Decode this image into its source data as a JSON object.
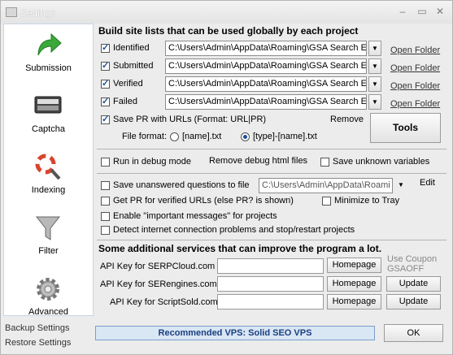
{
  "window": {
    "title": "Settings"
  },
  "sidebar": {
    "items": [
      {
        "label": "Submission",
        "icon": "green-arrow-icon"
      },
      {
        "label": "Captcha",
        "icon": "captcha-icon"
      },
      {
        "label": "Indexing",
        "icon": "lifebuoy-magnifier-icon"
      },
      {
        "label": "Filter",
        "icon": "funnel-icon"
      },
      {
        "label": "Advanced",
        "icon": "gear-icon"
      }
    ],
    "backup_label": "Backup Settings",
    "restore_label": "Restore Settings"
  },
  "sitelists": {
    "heading": "Build site lists that can be used globally by each project",
    "rows": [
      {
        "label": "Identified",
        "checked": true,
        "path": "C:\\Users\\Admin\\AppData\\Roaming\\GSA Search E",
        "open": "Open Folder"
      },
      {
        "label": "Submitted",
        "checked": true,
        "path": "C:\\Users\\Admin\\AppData\\Roaming\\GSA Search E",
        "open": "Open Folder"
      },
      {
        "label": "Verified",
        "checked": true,
        "path": "C:\\Users\\Admin\\AppData\\Roaming\\GSA Search E",
        "open": "Open Folder"
      },
      {
        "label": "Failed",
        "checked": true,
        "path": "C:\\Users\\Admin\\AppData\\Roaming\\GSA Search E",
        "open": "Open Folder"
      }
    ],
    "save_pr_label": "Save PR with URLs (Format: URL|PR)",
    "remove_label": "Remove",
    "file_format_label": "File format:",
    "format_option_1": "[name].txt",
    "format_option_2": "[type]-[name].txt",
    "tools_label": "Tools"
  },
  "debug": {
    "debug_mode_label": "Run in debug mode",
    "remove_debug_label": "Remove debug html files",
    "save_unknown_label": "Save unknown variables"
  },
  "options": {
    "save_unanswered_label": "Save unanswered questions to file",
    "unanswered_path": "C:\\Users\\Admin\\AppData\\Roami",
    "edit_label": "Edit",
    "get_pr_label": "Get PR for verified URLs (else PR? is shown)",
    "minimize_tray_label": "Minimize to Tray",
    "important_messages_label": "Enable \"important messages\" for projects",
    "detect_internet_label": "Detect internet connection problems and stop/restart projects"
  },
  "services": {
    "heading": "Some additional services that can improve the program a lot.",
    "coupon_line1": "Use Coupon",
    "coupon_line2": "GSAOFF",
    "rows": [
      {
        "label": "API Key for SERPCloud.com",
        "homepage": "Homepage",
        "update": ""
      },
      {
        "label": "API Key for SERengines.com",
        "homepage": "Homepage",
        "update": "Update"
      },
      {
        "label": "API Key for ScriptSold.com",
        "homepage": "Homepage",
        "update": "Update"
      }
    ]
  },
  "footer": {
    "vps_label": "Recommended VPS: Solid SEO VPS",
    "ok_label": "OK"
  },
  "colors": {
    "accent": "#1e4f9a",
    "vps_bg": "#d9e6f4"
  }
}
